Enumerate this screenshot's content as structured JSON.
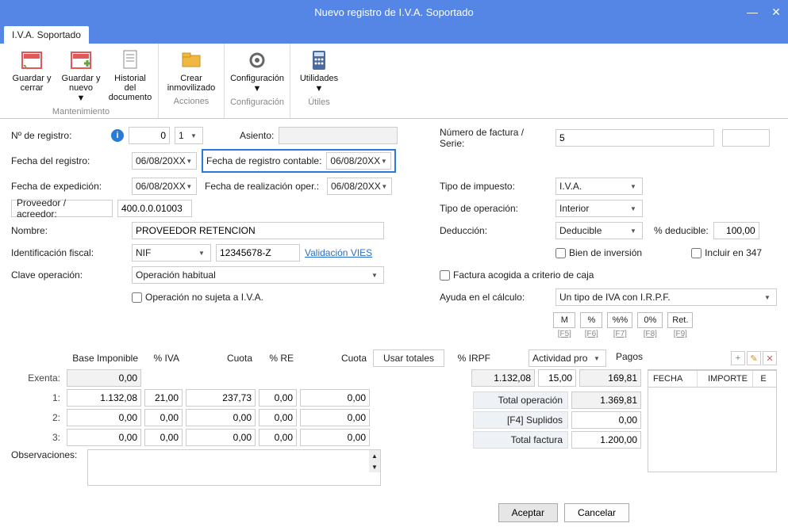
{
  "window": {
    "title": "Nuevo registro de I.V.A. Soportado"
  },
  "tab": {
    "label": "I.V.A. Soportado"
  },
  "ribbon": {
    "mantenimiento": {
      "label": "Mantenimiento",
      "guardar_cerrar": "Guardar y cerrar",
      "guardar_nuevo": "Guardar y nuevo",
      "historial": "Historial del documento"
    },
    "acciones": {
      "label": "Acciones",
      "crear_inmovilizado": "Crear inmovilizado"
    },
    "configuracion": {
      "label": "Configuración",
      "configuracion": "Configuración"
    },
    "utiles": {
      "label": "Útiles",
      "utilidades": "Utilidades"
    }
  },
  "form": {
    "n_registro_lbl": "Nº de registro:",
    "n_registro": "0",
    "n_registro_seq": "1",
    "asiento_lbl": "Asiento:",
    "asiento": "",
    "num_factura_lbl": "Número de factura / Serie:",
    "num_factura": "5",
    "serie": "",
    "fecha_registro_lbl": "Fecha del registro:",
    "fecha_registro": "06/08/20XX",
    "fecha_reg_contable_lbl": "Fecha de registro contable:",
    "fecha_reg_contable": "06/08/20XX",
    "fecha_expedicion_lbl": "Fecha de expedición:",
    "fecha_expedicion": "06/08/20XX",
    "fecha_realizacion_lbl": "Fecha de realización oper.:",
    "fecha_realizacion": "06/08/20XX",
    "proveedor_lbl": "Proveedor / acreedor:",
    "proveedor": "400.0.0.01003",
    "nombre_lbl": "Nombre:",
    "nombre": "PROVEEDOR RETENCION",
    "id_fiscal_lbl": "Identificación fiscal:",
    "id_fiscal_tipo": "NIF",
    "id_fiscal_num": "12345678-Z",
    "validacion_vies": "Validación VIES",
    "clave_op_lbl": "Clave operación:",
    "clave_op": "Operación habitual",
    "op_no_sujeta": "Operación no sujeta a I.V.A.",
    "tipo_impuesto_lbl": "Tipo de impuesto:",
    "tipo_impuesto": "I.V.A.",
    "tipo_operacion_lbl": "Tipo de operación:",
    "tipo_operacion": "Interior",
    "deduccion_lbl": "Deducción:",
    "deduccion": "Deducible",
    "pct_deducible_lbl": "% deducible:",
    "pct_deducible": "100,00",
    "bien_inversion": "Bien de inversión",
    "incluir_347": "Incluir en 347",
    "factura_caja": "Factura acogida a criterio de caja",
    "ayuda_calculo_lbl": "Ayuda en el cálculo:",
    "ayuda_calculo": "Un tipo de IVA con I.R.P.F.",
    "shortcuts": {
      "m": "M",
      "pct": "%",
      "pctpct": "%%",
      "zeropct": "0%",
      "ret": "Ret.",
      "f5": "[F5]",
      "f6": "[F6]",
      "f7": "[F7]",
      "f8": "[F8]",
      "f9": "[F9]"
    }
  },
  "grid": {
    "hdr": {
      "base": "Base Imponible",
      "iva": "% IVA",
      "cuota": "Cuota",
      "re": "% RE",
      "cuota2": "Cuota",
      "usar_totales": "Usar totales",
      "irpf": "% IRPF",
      "actividad": "Actividad pro"
    },
    "rows": [
      {
        "lbl": "Exenta:",
        "base": "0,00"
      },
      {
        "lbl": "1:",
        "base": "1.132,08",
        "iva": "21,00",
        "cuota": "237,73",
        "re": "0,00",
        "cuota2": "0,00"
      },
      {
        "lbl": "2:",
        "base": "0,00",
        "iva": "0,00",
        "cuota": "0,00",
        "re": "0,00",
        "cuota2": "0,00"
      },
      {
        "lbl": "3:",
        "base": "0,00",
        "iva": "0,00",
        "cuota": "0,00",
        "re": "0,00",
        "cuota2": "0,00"
      }
    ],
    "irpf_row": {
      "base": "1.132,08",
      "irpf": "15,00",
      "val": "169,81"
    },
    "observaciones_lbl": "Observaciones:"
  },
  "totals": {
    "total_operacion_lbl": "Total operación",
    "total_operacion": "1.369,81",
    "suplidos_lbl": "[F4] Suplidos",
    "suplidos": "0,00",
    "total_factura_lbl": "Total factura",
    "total_factura": "1.200,00"
  },
  "pagos": {
    "title": "Pagos",
    "col_fecha": "FECHA",
    "col_importe": "IMPORTE",
    "col_e": "E"
  },
  "footer": {
    "aceptar": "Aceptar",
    "cancelar": "Cancelar"
  }
}
